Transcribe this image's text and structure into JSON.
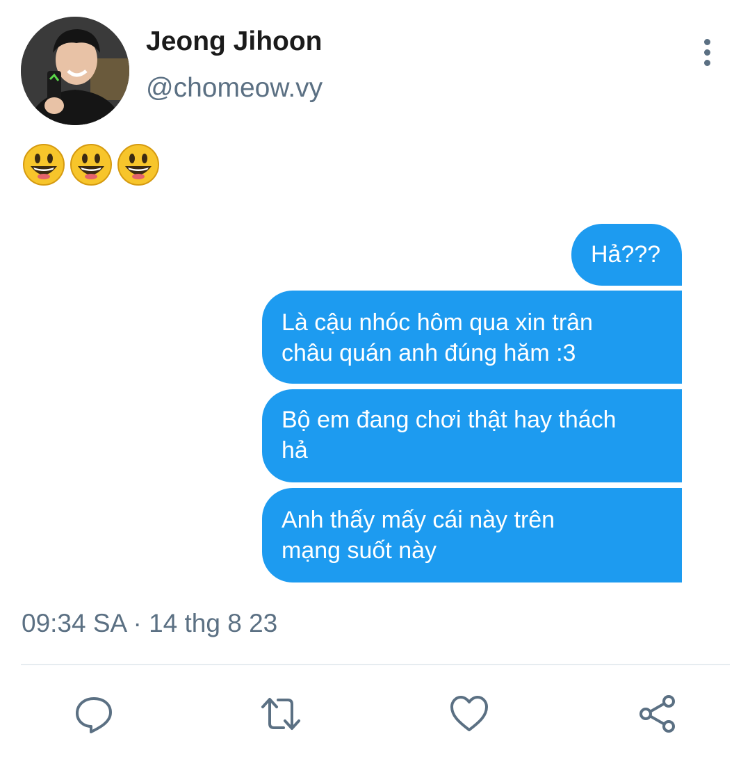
{
  "tweet": {
    "author_name": "Jeong Jihoon",
    "author_handle": "@chomeow.vy",
    "text_emojis": [
      "😃",
      "😃",
      "😃"
    ],
    "timestamp": "09:34 SA · 14 thg 8 23"
  },
  "chat": {
    "messages": [
      {
        "lines": [
          "Hả???"
        ]
      },
      {
        "lines": [
          "Là cậu nhóc hôm qua xin trân",
          "châu quán anh đúng hăm :3"
        ]
      },
      {
        "lines": [
          "Bộ em đang chơi thật hay thách",
          "hả"
        ]
      },
      {
        "lines": [
          "Anh thấy mấy cái này trên",
          "mạng suốt này"
        ]
      }
    ],
    "bubble_color": "#1d9bf0"
  },
  "actions": [
    "reply-icon",
    "retweet-icon",
    "like-icon",
    "share-icon"
  ],
  "colors": {
    "muted_text": "#5b7083",
    "divider": "#e6ecf0"
  }
}
